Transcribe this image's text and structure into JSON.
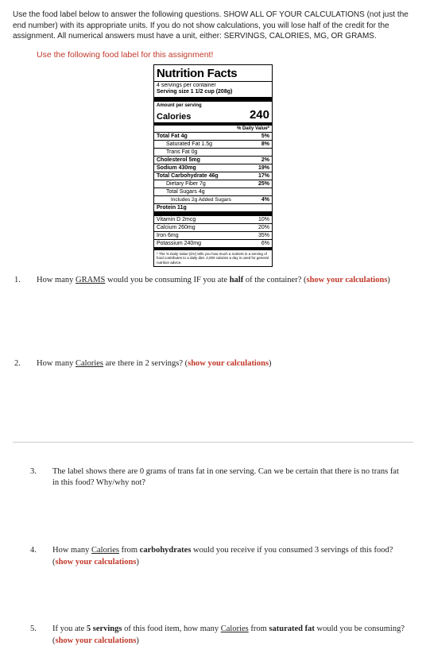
{
  "instructions": "Use the food label below to answer the following questions. SHOW ALL OF YOUR CALCULATIONS (not just the end number) with its appropriate units. If you do not show calculations, you will lose half of the credit for the assignment. All numerical answers must have a unit, either: SERVINGS, CALORIES, MG, OR GRAMS.",
  "red_heading": "Use the following food label for this assignment!",
  "label": {
    "title": "Nutrition Facts",
    "servings_per": "4 servings per container",
    "serving_size": "Serving size 1 1/2 cup (208g)",
    "amount_per": "Amount per serving",
    "cal_label": "Calories",
    "cal_value": "240",
    "dv_header": "% Daily Value*",
    "rows": {
      "total_fat": "Total Fat 4g",
      "total_fat_dv": "5%",
      "sat_fat": "Saturated Fat 1.5g",
      "sat_fat_dv": "8%",
      "trans_fat": "Trans Fat 0g",
      "cholesterol": "Cholesterol 5mg",
      "cholesterol_dv": "2%",
      "sodium": "Sodium 430mg",
      "sodium_dv": "19%",
      "total_carb": "Total Carbohydrate 46g",
      "total_carb_dv": "17%",
      "fiber": "Dietary Fiber 7g",
      "fiber_dv": "25%",
      "sugars": "Total Sugars 4g",
      "added_sugars": "Includes 2g Added Sugars",
      "added_sugars_dv": "4%",
      "protein": "Protein 11g",
      "vit_d": "Vitamin D 2mcg",
      "vit_d_dv": "10%",
      "calcium": "Calcium 260mg",
      "calcium_dv": "20%",
      "iron": "Iron 6mg",
      "iron_dv": "35%",
      "potassium": "Potassium 240mg",
      "potassium_dv": "6%"
    },
    "footer": "* The % Daily Value (DV) tells you how much a nutrient in a serving of food contributes to a daily diet. 2,000 calories a day is used for general nutrition advice."
  },
  "q": {
    "n1": "1.",
    "q1a": "How many ",
    "q1b": "GRAMS",
    "q1c": " would you be consuming IF you ate ",
    "q1d": "half",
    "q1e": " of the container? (",
    "q1f": "show your calculations",
    "q1g": ")",
    "n2": "2.",
    "q2a": "How many ",
    "q2b": "Calories",
    "q2c": " are there in 2 servings? (",
    "q2d": "show your calculations",
    "q2e": ")",
    "n3": "3.",
    "q3": "The label shows there are 0 grams of trans fat in one serving.  Can we be certain that there is no trans fat in this food? Why/why not?",
    "n4": "4.",
    "q4a": "How many ",
    "q4b": "Calories",
    "q4c": " from ",
    "q4d": "carbohydrates",
    "q4e": " would you receive if you consumed 3 servings of this food? (",
    "q4f": "show your calculations",
    "q4g": ")",
    "n5": "5.",
    "q5a": "If you ate ",
    "q5b": "5 servings",
    "q5c": " of this food item, how many ",
    "q5d": "Calories",
    "q5e": " from ",
    "q5f": "saturated fat",
    "q5g": " would you be consuming? (",
    "q5h": "show your calculations",
    "q5i": ")"
  }
}
